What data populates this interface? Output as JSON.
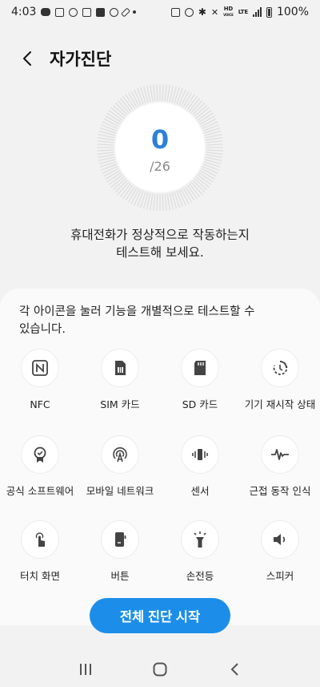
{
  "status_bar": {
    "time": "4:03",
    "battery": "100%",
    "hd_label": "HD",
    "voice_label": "VOICE",
    "lte_label": "LTE"
  },
  "header": {
    "title": "자가진단"
  },
  "gauge": {
    "score": "0",
    "total": "/26",
    "accent_color": "#2d80d8"
  },
  "description": {
    "line1": "휴대전화가 정상적으로 작동하는지",
    "line2": "테스트해 보세요."
  },
  "card": {
    "instruction_line1": "각 아이콘을 눌러 기능을 개별적으로 테스트할 수",
    "instruction_line2": "있습니다.",
    "items": [
      {
        "label": "NFC",
        "icon": "nfc-icon"
      },
      {
        "label": "SIM 카드",
        "icon": "sim-card-icon"
      },
      {
        "label": "SD 카드",
        "icon": "sd-card-icon"
      },
      {
        "label": "기기 재시작 상태",
        "icon": "restart-icon"
      },
      {
        "label": "공식 소프트웨어",
        "icon": "badge-icon"
      },
      {
        "label": "모바일 네트워크",
        "icon": "antenna-icon"
      },
      {
        "label": "센서",
        "icon": "vibration-icon"
      },
      {
        "label": "근접 동작 인식",
        "icon": "pulse-icon"
      },
      {
        "label": "터치 화면",
        "icon": "touch-icon"
      },
      {
        "label": "버튼",
        "icon": "phone-button-icon"
      },
      {
        "label": "손전등",
        "icon": "flashlight-icon"
      },
      {
        "label": "스피커",
        "icon": "speaker-icon"
      }
    ]
  },
  "start_button": {
    "label": "전체 진단 시작",
    "color": "#1c8eea"
  }
}
